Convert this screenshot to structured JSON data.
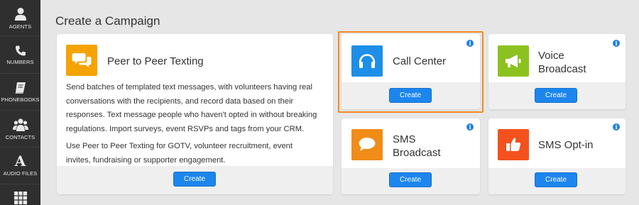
{
  "sidebar": {
    "items": [
      {
        "label": "AGENTS",
        "icon": "agent-icon"
      },
      {
        "label": "NUMBERS",
        "icon": "phone-icon"
      },
      {
        "label": "PHONEBOOKS",
        "icon": "book-icon"
      },
      {
        "label": "CONTACTS",
        "icon": "people-icon"
      },
      {
        "label": "AUDIO FILES",
        "icon": "font-icon"
      },
      {
        "label": "",
        "icon": "grid-icon"
      }
    ]
  },
  "page": {
    "title": "Create a Campaign"
  },
  "colors": {
    "accent": "#1c86ee",
    "highlight": "#f5891f",
    "p2p": "#f5a300",
    "callcenter": "#1e8fe8",
    "voice": "#8cc21f",
    "sms": "#f08c17",
    "optin": "#f4511e"
  },
  "cards": {
    "p2p": {
      "title": "Peer to Peer Texting",
      "icon": "chat-bubbles-icon",
      "description": [
        "Send batches of templated text messages, with volunteers having real conversations with the recipients, and record data based on their responses. Text message people who haven't opted in without breaking regulations. Import surveys, event RSVPs and tags from your CRM.",
        "Use Peer to Peer Texting for GOTV, volunteer recruitment, event invites, fundraising or supporter engagement."
      ],
      "button": "Create"
    },
    "call_center": {
      "title": "Call Center",
      "icon": "headset-icon",
      "button": "Create",
      "info": "i"
    },
    "voice": {
      "title_line1": "Voice",
      "title_line2": "Broadcast",
      "icon": "megaphone-icon",
      "button": "Create",
      "info": "i"
    },
    "sms": {
      "title_line1": "SMS",
      "title_line2": "Broadcast",
      "icon": "chat-bubble-icon",
      "button": "Create",
      "info": "i"
    },
    "optin": {
      "title": "SMS Opt-in",
      "icon": "thumbs-up-icon",
      "button": "Create",
      "info": "i"
    }
  }
}
